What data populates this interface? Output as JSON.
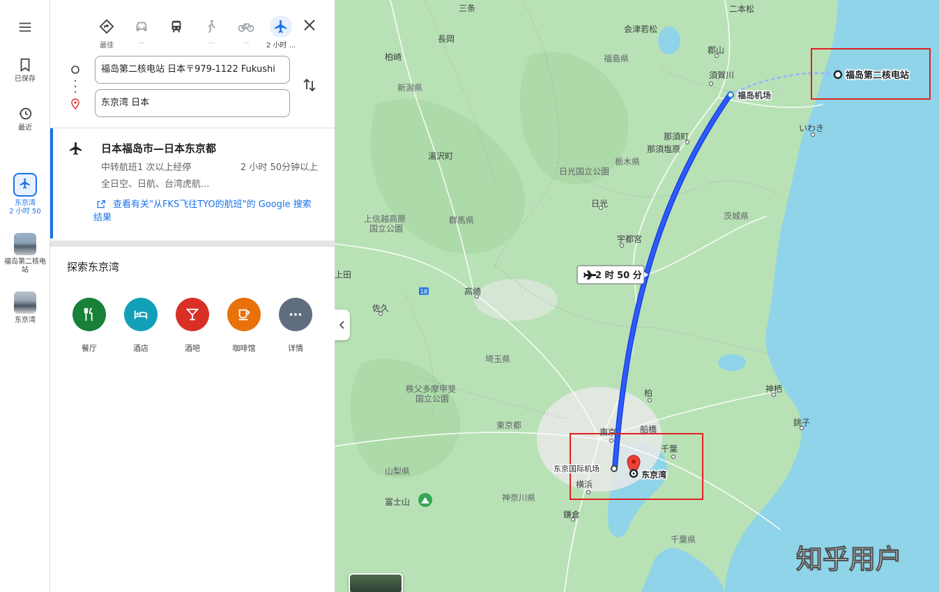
{
  "rail": {
    "saved_label": "已保存",
    "recent_label": "最近",
    "active_label": "东京湾",
    "active_sub": "2 小时 50",
    "history": [
      {
        "label": "福岛第二核电站"
      },
      {
        "label": "东京湾"
      }
    ]
  },
  "modes": [
    {
      "name": "最佳",
      "sub": "最佳"
    },
    {
      "name": "驾车",
      "sub": "—"
    },
    {
      "name": "公共交通",
      "sub": ""
    },
    {
      "name": "步行",
      "sub": "—"
    },
    {
      "name": "骑行",
      "sub": "—"
    },
    {
      "name": "飞机",
      "sub": "2 小时 ..."
    }
  ],
  "directions": {
    "origin": "福岛第二核电站 日本〒979-1122 Fukushi",
    "destination": "东京湾 日本"
  },
  "route": {
    "title": "日本福岛市—日本东京都",
    "detail": "中转航班1 次以上经停",
    "duration": "2 小时 50分钟以上",
    "airlines": "全日空、日航、台湾虎航...",
    "link": "查看有关\"从FKS飞往TYO的航班\"的 Google 搜索结果"
  },
  "explore": {
    "title": "探索东京湾",
    "items": [
      {
        "label": "餐厅",
        "color": "#188038"
      },
      {
        "label": "酒店",
        "color": "#12a0b8"
      },
      {
        "label": "酒吧",
        "color": "#d93025"
      },
      {
        "label": "咖啡馆",
        "color": "#e8710a"
      },
      {
        "label": "详情",
        "color": "#5f6d7e"
      }
    ]
  },
  "map": {
    "flight_badge": "2 时 50 分",
    "origin_label": "福岛第二核电站",
    "airport_origin": "福岛机场",
    "airport_dest": "东京国际机场",
    "dest_label": "东京湾",
    "watermark": "知乎用户",
    "labels": {
      "fukushima_pref": "福島県",
      "niigata_pref": "新潟県",
      "koriyama": "郡山",
      "sukagawa": "須賀川",
      "aizu": "会津若松",
      "nihonmatsu": "二本松",
      "iwaki": "いわき",
      "nasu": "那須町",
      "nasushiobara": "那須塩原",
      "tochigi": "栃木県",
      "nikko_park": "日光国立公園",
      "nikko": "日光",
      "utsunomiya": "宇都宮",
      "ibaraki": "茨城県",
      "gunma": "群馬県",
      "joshinetsu": "上信越高原",
      "joshinetsu2": "国立公園",
      "takasaki": "高崎",
      "saitama": "埼玉県",
      "chichibu": "秩父多摩甲斐",
      "chichibu2": "国立公園",
      "tokyo_to": "東京都",
      "tokyo": "東京",
      "funabashi": "船橋",
      "chiba": "千葉",
      "kashiwa": "柏",
      "yokohama": "横浜",
      "yamanashi": "山梨県",
      "fuji": "富士山",
      "kanagawa": "神奈川県",
      "chiba_pref": "千葉県",
      "kamisu": "神栖",
      "choshi": "銚子",
      "yuzawa": "湯沢町",
      "kashiwazaki": "柏崎",
      "nagaoka": "長岡",
      "sano": "佐久",
      "sanjo": "三条",
      "kamakura": "鎌倉",
      "ueda": "上田",
      "road18": "18"
    }
  }
}
